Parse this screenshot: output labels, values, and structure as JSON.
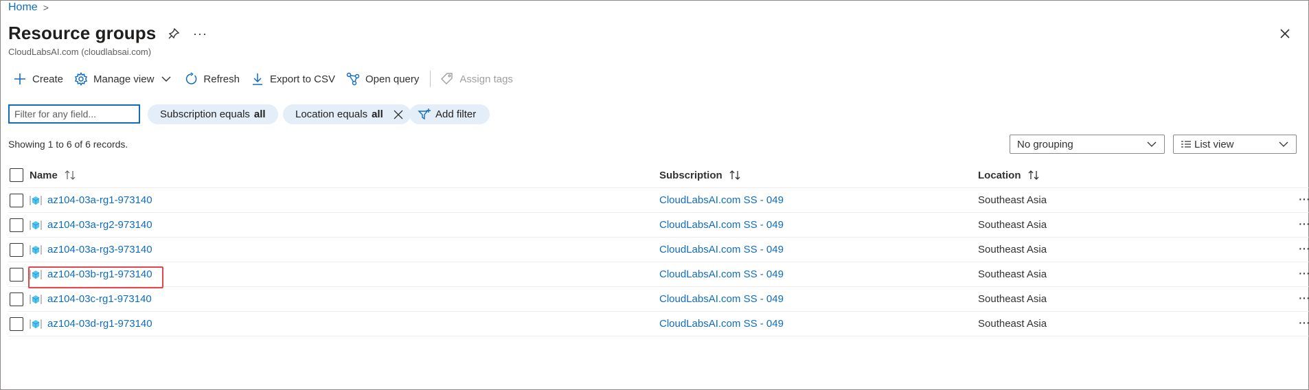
{
  "breadcrumb": {
    "home": "Home",
    "separator": ">"
  },
  "header": {
    "title": "Resource groups",
    "subtitle": "CloudLabsAI.com (cloudlabsai.com)",
    "more": "···"
  },
  "toolbar": {
    "create": "Create",
    "manage_view": "Manage view",
    "refresh": "Refresh",
    "export_csv": "Export to CSV",
    "open_query": "Open query",
    "assign_tags": "Assign tags"
  },
  "filters": {
    "search_placeholder": "Filter for any field...",
    "subscription_prefix": "Subscription equals",
    "subscription_value": "all",
    "location_prefix": "Location equals",
    "location_value": "all",
    "add_filter": "Add filter"
  },
  "showing": "Showing 1 to 6 of 6 records.",
  "grouping": {
    "selected": "No grouping"
  },
  "view": {
    "selected": "List view"
  },
  "table": {
    "columns": {
      "name": "Name",
      "subscription": "Subscription",
      "location": "Location"
    },
    "rows": [
      {
        "name": "az104-03a-rg1-973140",
        "subscription": "CloudLabsAI.com SS - 049",
        "location": "Southeast Asia"
      },
      {
        "name": "az104-03a-rg2-973140",
        "subscription": "CloudLabsAI.com SS - 049",
        "location": "Southeast Asia"
      },
      {
        "name": "az104-03a-rg3-973140",
        "subscription": "CloudLabsAI.com SS - 049",
        "location": "Southeast Asia"
      },
      {
        "name": "az104-03b-rg1-973140",
        "subscription": "CloudLabsAI.com SS - 049",
        "location": "Southeast Asia"
      },
      {
        "name": "az104-03c-rg1-973140",
        "subscription": "CloudLabsAI.com SS - 049",
        "location": "Southeast Asia"
      },
      {
        "name": "az104-03d-rg1-973140",
        "subscription": "CloudLabsAI.com SS - 049",
        "location": "Southeast Asia"
      }
    ],
    "row_more": "···"
  },
  "colors": {
    "accent": "#0f6cbd",
    "pill": "#e3eef9",
    "highlight": "#e0474c"
  }
}
